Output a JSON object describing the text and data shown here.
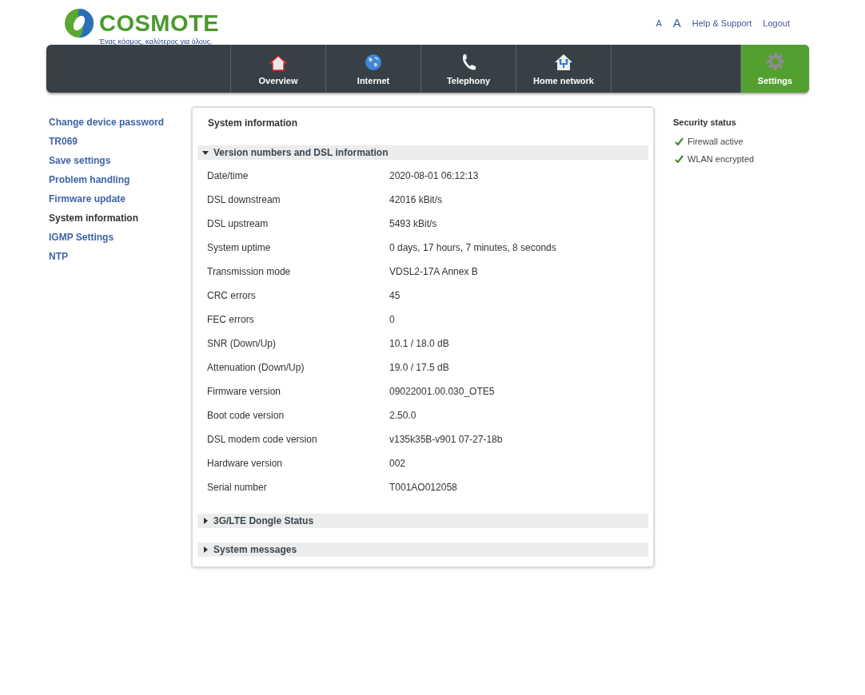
{
  "header": {
    "brand": "COSMOTE",
    "tagline": "Ένας κόσμος, καλύτερος για όλους.",
    "links": [
      {
        "label": "A",
        "kind": "font-small"
      },
      {
        "label": "A",
        "kind": "font-large"
      },
      {
        "label": "Help & Support",
        "kind": "link"
      },
      {
        "label": "Logout",
        "kind": "link"
      }
    ]
  },
  "nav": [
    {
      "label": "Overview",
      "kind": "house",
      "selected": false
    },
    {
      "label": "Internet",
      "kind": "globe",
      "selected": false
    },
    {
      "label": "Telephony",
      "kind": "phone",
      "selected": false
    },
    {
      "label": "Home network",
      "kind": "network",
      "selected": false
    },
    {
      "label": "Settings",
      "kind": "gear",
      "selected": true
    }
  ],
  "sidebar": {
    "items": [
      {
        "label": "Change device password",
        "selected": false
      },
      {
        "label": "TR069",
        "selected": false
      },
      {
        "label": "Save settings",
        "selected": false
      },
      {
        "label": "Problem handling",
        "selected": false
      },
      {
        "label": "Firmware update",
        "selected": false
      },
      {
        "label": "System information",
        "selected": true
      },
      {
        "label": "IGMP Settings",
        "selected": false
      },
      {
        "label": "NTP",
        "selected": false
      }
    ]
  },
  "panel": {
    "title": "System information",
    "sections": [
      {
        "title": "Version numbers and DSL information",
        "expanded": true,
        "rows": [
          {
            "label": "Date/time",
            "value": "2020-08-01 06:12:13"
          },
          {
            "label": "DSL downstream",
            "value": "42016 kBit/s"
          },
          {
            "label": "DSL upstream",
            "value": "5493 kBit/s"
          },
          {
            "label": "System uptime",
            "value": "0 days, 17 hours, 7 minutes, 8 seconds"
          },
          {
            "label": "Transmission mode",
            "value": "VDSL2-17A Annex B"
          },
          {
            "label": "CRC errors",
            "value": "45"
          },
          {
            "label": "FEC errors",
            "value": "0"
          },
          {
            "label": "SNR (Down/Up)",
            "value": "10.1 / 18.0 dB"
          },
          {
            "label": "Attenuation (Down/Up)",
            "value": "19.0 / 17.5 dB"
          },
          {
            "label": "Firmware version",
            "value": "09022001.00.030_OTE5"
          },
          {
            "label": "Boot code version",
            "value": "2.50.0"
          },
          {
            "label": "DSL modem code version",
            "value": "v135k35B-v901 07-27-18b"
          },
          {
            "label": "Hardware version",
            "value": "002"
          },
          {
            "label": "Serial number",
            "value": "T001AO012058"
          }
        ]
      },
      {
        "title": "3G/LTE Dongle Status",
        "expanded": false
      },
      {
        "title": "System messages",
        "expanded": false
      }
    ]
  },
  "security_status": {
    "title": "Security status",
    "items": [
      {
        "label": "Firewall active",
        "ok": true
      },
      {
        "label": "WLAN encrypted",
        "ok": true
      }
    ]
  }
}
